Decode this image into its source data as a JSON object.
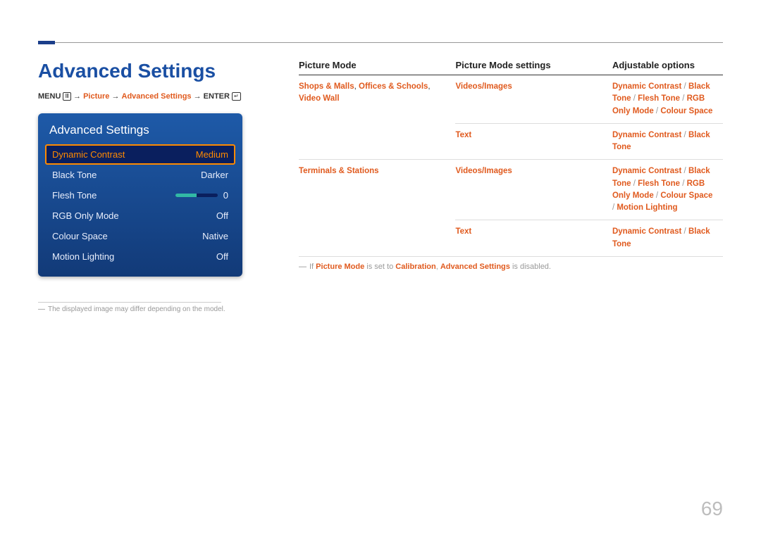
{
  "page": {
    "title": "Advanced Settings",
    "breadcrumb": {
      "menu": "MENU",
      "arrow": "→",
      "p1": "Picture",
      "p2": "Advanced Settings",
      "enter": "ENTER"
    },
    "footnote1": "The displayed image may differ depending on the model.",
    "note2_pre": "If ",
    "note2_pm": "Picture Mode",
    "note2_mid": " is set to ",
    "note2_cal": "Calibration",
    "note2_mid2": ", ",
    "note2_as": "Advanced Settings",
    "note2_post": " is disabled.",
    "number": "69"
  },
  "osd": {
    "title": "Advanced Settings",
    "rows": [
      {
        "label": "Dynamic Contrast",
        "value": "Medium",
        "selected": true
      },
      {
        "label": "Black Tone",
        "value": "Darker"
      },
      {
        "label": "Flesh Tone",
        "value": "0",
        "slider": true
      },
      {
        "label": "RGB Only Mode",
        "value": "Off"
      },
      {
        "label": "Colour Space",
        "value": "Native"
      },
      {
        "label": "Motion Lighting",
        "value": "Off"
      }
    ]
  },
  "table": {
    "headers": [
      "Picture Mode",
      "Picture Mode settings",
      "Adjustable options"
    ],
    "rows": [
      {
        "mode_parts": [
          "Shops & Malls",
          ", ",
          "Offices & Schools",
          ", ",
          "Video Wall"
        ],
        "setting": "Videos/Images",
        "options": [
          "Dynamic Contrast",
          " / ",
          "Black Tone",
          " / ",
          "Flesh Tone",
          " / ",
          "RGB Only Mode",
          " / ",
          "Colour Space"
        ]
      },
      {
        "mode_parts": [],
        "setting": "Text",
        "options": [
          "Dynamic Contrast",
          " / ",
          "Black Tone"
        ]
      },
      {
        "mode_parts": [
          "Terminals & Stations"
        ],
        "setting": "Videos/Images",
        "options": [
          "Dynamic Contrast",
          " / ",
          "Black Tone",
          " / ",
          "Flesh Tone",
          " / ",
          "RGB Only Mode",
          " / ",
          "Colour Space",
          " / ",
          "Motion Lighting"
        ]
      },
      {
        "mode_parts": [],
        "setting": "Text",
        "options": [
          "Dynamic Contrast",
          " / ",
          "Black Tone"
        ]
      }
    ]
  }
}
